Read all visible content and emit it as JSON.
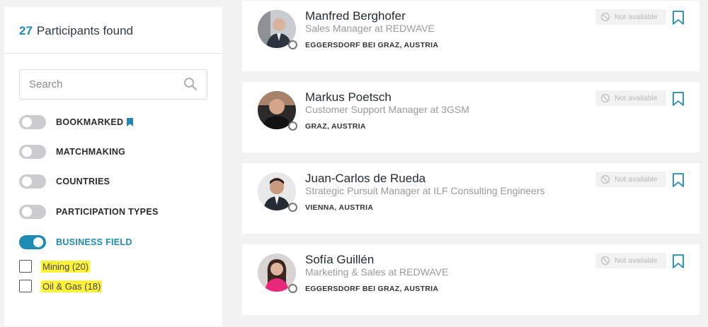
{
  "sidebar": {
    "count": "27",
    "count_label": "Participants found",
    "search": {
      "placeholder": "Search",
      "value": ""
    },
    "filters": [
      {
        "label": "BOOKMARKED",
        "on": false
      },
      {
        "label": "MATCHMAKING",
        "on": false
      },
      {
        "label": "COUNTRIES",
        "on": false
      },
      {
        "label": "PARTICIPATION TYPES",
        "on": false
      },
      {
        "label": "BUSINESS FIELD",
        "on": true
      }
    ],
    "business_options": [
      {
        "label": "Mining (20)",
        "checked": false
      },
      {
        "label": "Oil & Gas (18)",
        "checked": false
      }
    ]
  },
  "participants": [
    {
      "name": "Manfred Berghofer",
      "role": "Sales Manager at REDWAVE",
      "location": "EGGERSDORF BEI GRAZ, AUSTRIA",
      "availability": "Not available"
    },
    {
      "name": "Markus Poetsch",
      "role": "Customer Support Manager at 3GSM",
      "location": "GRAZ, AUSTRIA",
      "availability": "Not available"
    },
    {
      "name": "Juan-Carlos de Rueda",
      "role": "Strategic Pursuit Manager at ILF Consulting Engineers",
      "location": "VIENNA, AUSTRIA",
      "availability": "Not available"
    },
    {
      "name": "Sofía Guillén",
      "role": "Marketing & Sales at REDWAVE",
      "location": "EGGERSDORF BEI GRAZ, AUSTRIA",
      "availability": "Not available"
    }
  ],
  "colors": {
    "accent": "#1d8bb3",
    "highlight": "#fff23a",
    "toggle_off": "#c9cdd0"
  },
  "icons": {
    "search": "search-icon",
    "bookmark": "bookmark-icon",
    "availability": "ban-icon"
  }
}
